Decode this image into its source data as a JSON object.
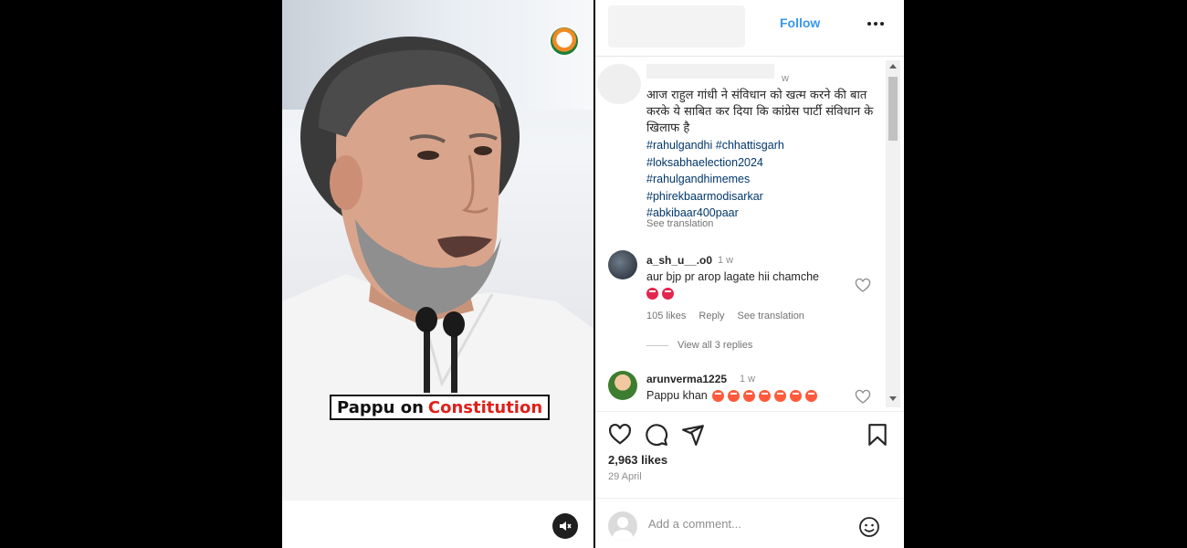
{
  "media": {
    "caption_white": "Pappu on",
    "caption_red": "Constitution"
  },
  "header": {
    "follow_label": "Follow"
  },
  "post": {
    "time": "w",
    "caption": "आज राहुल गांधी ने संविधान को खत्म करने की बात करके ये साबित कर दिया कि कांग्रेस पार्टी संविधान के खिलाफ है",
    "hashtags": [
      "#rahulgandhi #chhattisgarh",
      "#loksabhaelection2024",
      "#rahulgandhimemes",
      "#phirekbaarmodisarkar",
      "#abkibaar400paar"
    ],
    "see_translation": "See translation"
  },
  "comments": [
    {
      "username": "a_sh_u__.o0",
      "time": "1 w",
      "text": "aur bjp pr arop lagate hii chamche",
      "likes": "105 likes",
      "reply": "Reply",
      "see_translation": "See translation",
      "view_replies": "View all 3 replies"
    },
    {
      "username": "arunverma1225",
      "time": "1 w",
      "text": "Pappu khan"
    }
  ],
  "actions": {
    "likes": "2,963 likes",
    "date": "29 April"
  },
  "comment_box": {
    "placeholder": "Add a comment..."
  },
  "colors": {
    "link": "#3797f0",
    "hashtag": "#00376b",
    "caption_red": "#e0201b"
  },
  "icons": [
    "heart-icon",
    "comment-icon",
    "share-icon",
    "bookmark-icon",
    "more-icon",
    "mute-icon",
    "emoji-icon"
  ]
}
